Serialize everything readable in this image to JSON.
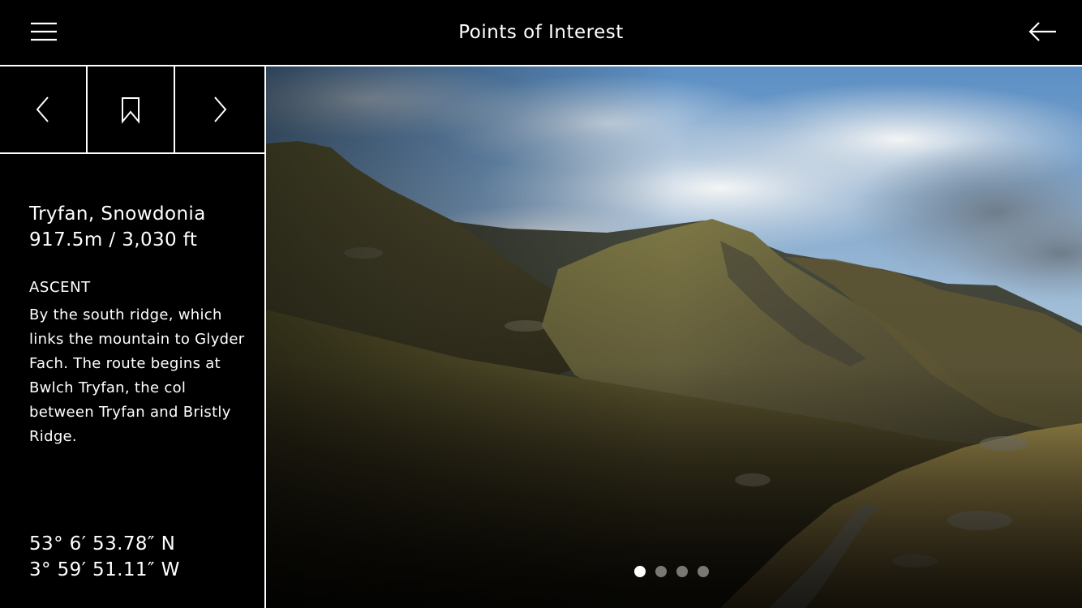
{
  "header": {
    "title": "Points of Interest",
    "menu_icon": "hamburger-menu-icon",
    "back_icon": "arrow-left-icon"
  },
  "nav": {
    "prev_icon": "chevron-left-icon",
    "bookmark_icon": "bookmark-icon",
    "next_icon": "chevron-right-icon"
  },
  "poi": {
    "name": "Tryfan, Snowdonia",
    "elevation": "917.5m / 3,030 ft",
    "section_heading": "ASCENT",
    "description": "By the south ridge, which links the mountain to Glyder Fach. The route begins at Bwlch Tryfan, the col between Tryfan and Bristly Ridge.",
    "latitude": "53° 6′ 53.78″ N",
    "longitude": "3° 59′ 51.11″ W"
  },
  "gallery": {
    "image_subject": "mountain landscape photo",
    "page_count": 4,
    "active_page": 1
  },
  "colors": {
    "background": "#000000",
    "text": "#ffffff",
    "divider": "#ffffff"
  }
}
